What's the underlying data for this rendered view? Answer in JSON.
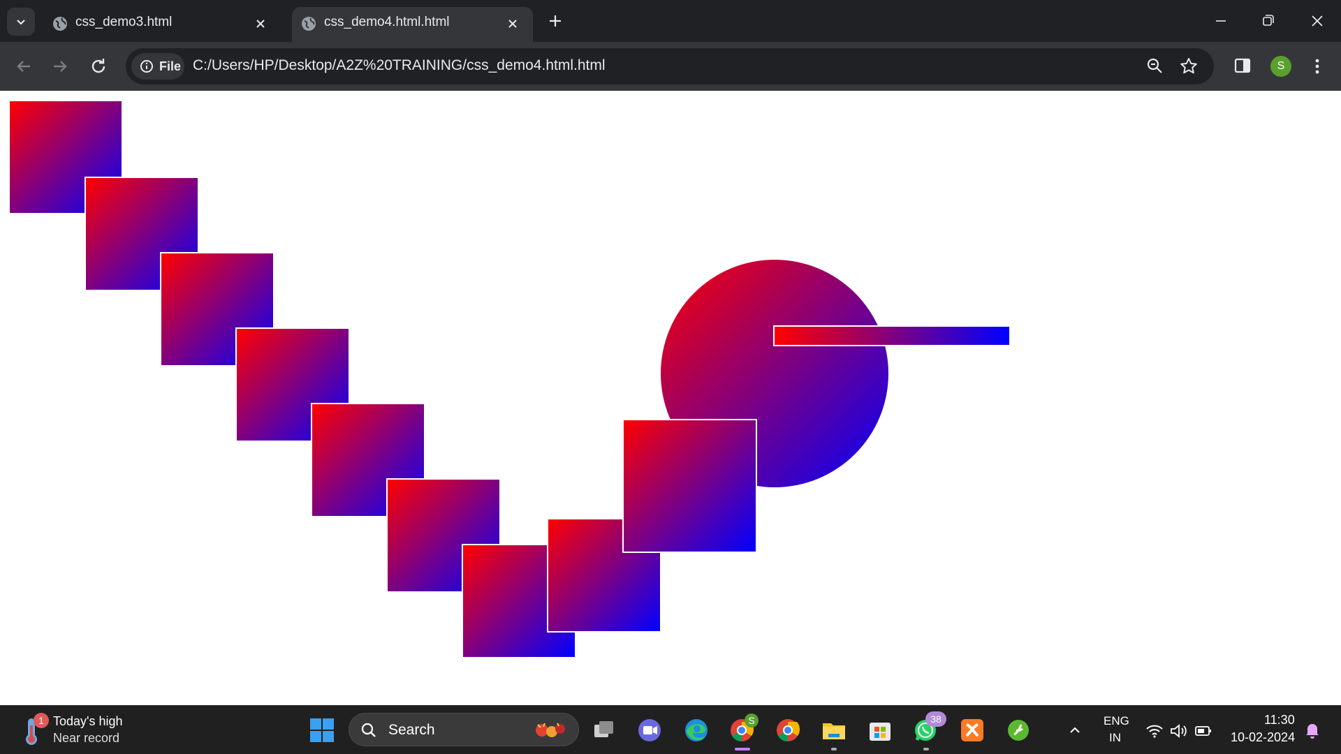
{
  "browser": {
    "tabs": [
      {
        "title": "css_demo3.html",
        "active": false
      },
      {
        "title": "css_demo4.html.html",
        "active": true
      }
    ],
    "site_chip": "File",
    "url": "C:/Users/HP/Desktop/A2Z%20TRAINING/css_demo4.html.html",
    "profile_initial": "S"
  },
  "page": {
    "gradient_colors": [
      "#ff0000",
      "#0000ff"
    ]
  },
  "taskbar": {
    "weather": {
      "badge": "1",
      "line1": "Today's high",
      "line2": "Near record"
    },
    "search_placeholder": "Search",
    "chrome_badge": "S",
    "whatsapp_badge": "38",
    "language": {
      "line1": "ENG",
      "line2": "IN"
    },
    "clock": {
      "time": "11:30",
      "date": "10-02-2024"
    }
  }
}
